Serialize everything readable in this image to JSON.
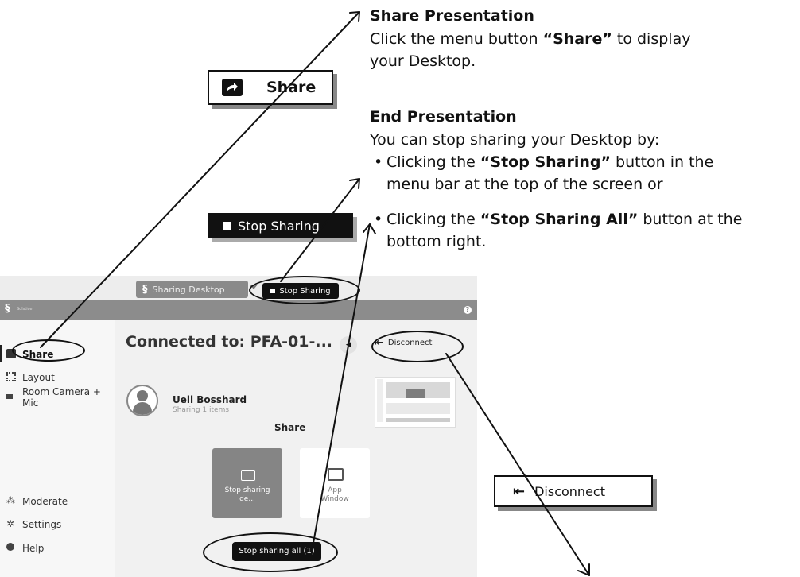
{
  "share_section": {
    "title": "Share Presentation",
    "line1_pre": "Click the menu button ",
    "line1_bold": "“Share”",
    "line1_post": " to display",
    "line2": "your Desktop."
  },
  "end_section": {
    "title": "End Presentation",
    "intro": "You can stop sharing your Desktop by:",
    "bullet1_pre": "Clicking the ",
    "bullet1_bold": "“Stop Sharing”",
    "bullet1_post": " button in the",
    "bullet1_line2": "menu bar at the top of the screen or",
    "bullet2_pre": "Clicking the ",
    "bullet2_bold": "“Stop Sharing All”",
    "bullet2_post": " button at the",
    "bullet2_line2": "bottom right."
  },
  "callouts": {
    "share": "Share",
    "stop_sharing": "Stop Sharing",
    "disconnect": "Disconnect"
  },
  "app": {
    "sharing_desktop": "Sharing Desktop",
    "stop_sharing": "Stop Sharing",
    "brand": "Solstice",
    "help_badge": "?",
    "sidebar": [
      "Share",
      "Layout",
      "Room Camera + Mic",
      "Moderate",
      "Settings",
      "Help"
    ],
    "connected_to": "Connected to: PFA-01-...",
    "disconnect": "Disconnect",
    "user_name": "Ueli Bosshard",
    "user_status": "Sharing 1 items",
    "share_heading": "Share",
    "tile_stop": "Stop sharing de...",
    "tile_app": "App Window",
    "stop_all": "Stop sharing all (1)"
  }
}
